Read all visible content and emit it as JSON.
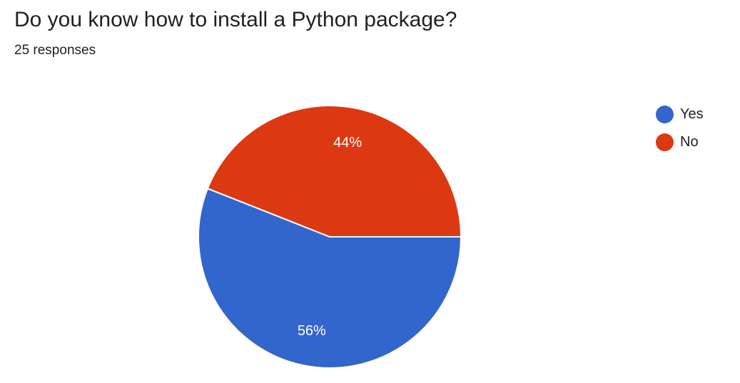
{
  "question": {
    "title": "Do you know how to install a Python package?",
    "responses": "25 responses"
  },
  "chart_data": {
    "type": "pie",
    "title": "Do you know how to install a Python package?",
    "subtitle": "25 responses",
    "categories": [
      "Yes",
      "No"
    ],
    "values": [
      56,
      44
    ],
    "labels": [
      "56%",
      "44%"
    ],
    "colors": [
      "#3366cc",
      "#dc3912"
    ],
    "legend_position": "right"
  }
}
